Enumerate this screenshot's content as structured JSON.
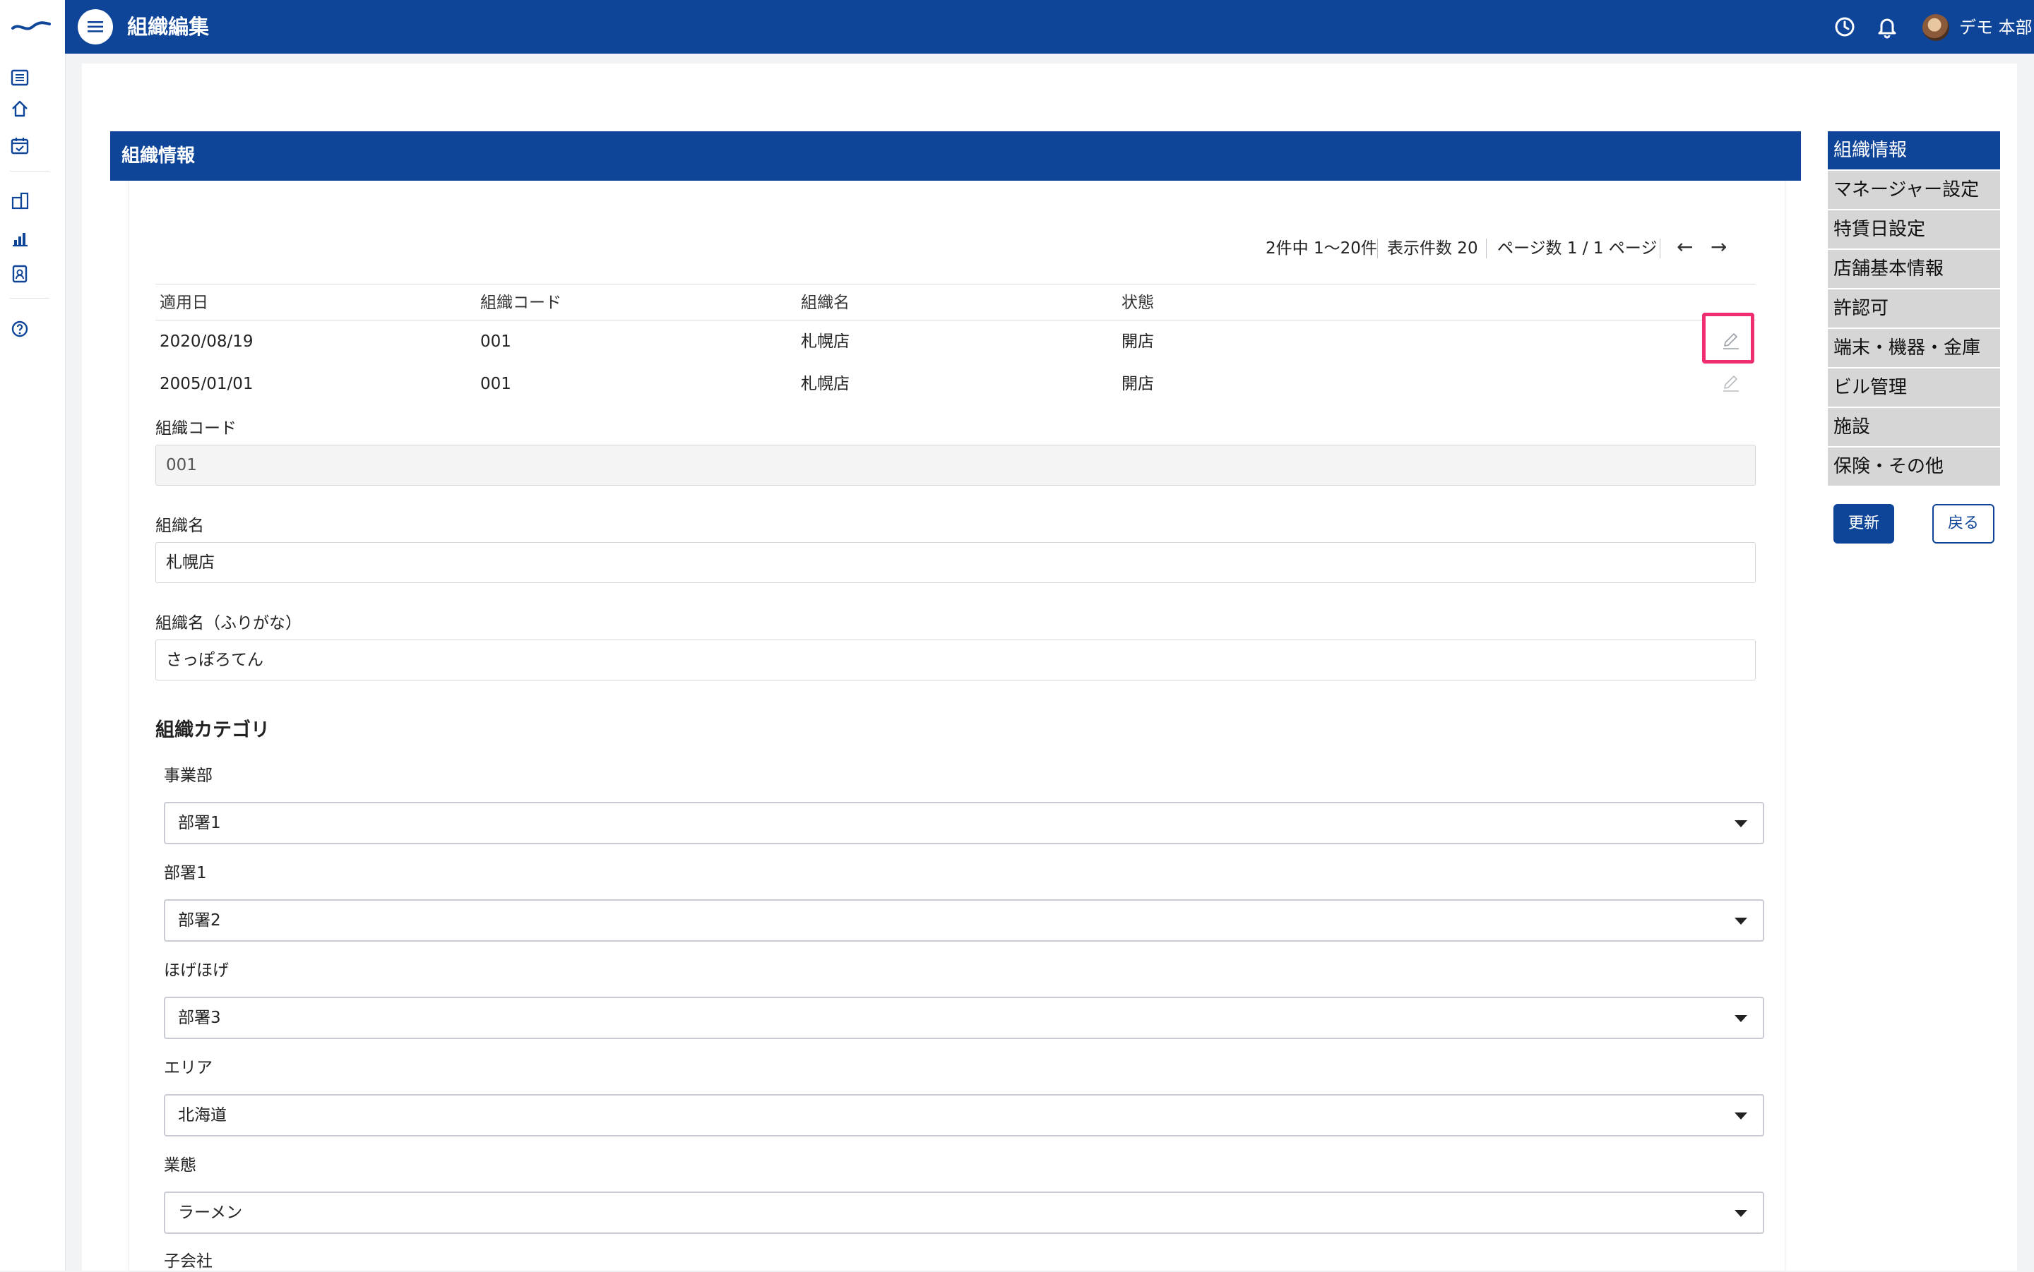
{
  "header": {
    "title": "組織編集",
    "user_name": "デモ 本部",
    "icons": [
      "hamburger-icon",
      "history-clock-icon",
      "bell-icon",
      "avatar"
    ]
  },
  "sidebar": {
    "icons": [
      "list-icon",
      "home-icon",
      "calendar-check-icon",
      "building-icon",
      "bar-chart-icon",
      "id-badge-icon",
      "help-icon"
    ]
  },
  "section": {
    "title": "組織情報"
  },
  "pagination": {
    "summary": "2件中 1〜20件",
    "per_page": "表示件数 20",
    "pages": "ページ数 1 / 1 ページ",
    "prev": "←",
    "next": "→"
  },
  "history_table": {
    "headers": [
      "適用日",
      "組織コード",
      "組織名",
      "状態"
    ],
    "rows": [
      {
        "date": "2020/08/19",
        "code": "001",
        "name": "札幌店",
        "status": "開店"
      },
      {
        "date": "2005/01/01",
        "code": "001",
        "name": "札幌店",
        "status": "開店"
      }
    ]
  },
  "form": {
    "code_label": "組織コード",
    "code_value": "001",
    "name_label": "組織名",
    "name_value": "札幌店",
    "kana_label": "組織名（ふりがな）",
    "kana_value": "さっぽろてん"
  },
  "category": {
    "title": "組織カテゴリ",
    "fields": [
      {
        "label": "事業部",
        "value": "部署1"
      },
      {
        "label": "部署1",
        "value": "部署2"
      },
      {
        "label": "ほげほげ",
        "value": "部署3"
      },
      {
        "label": "エリア",
        "value": "北海道"
      },
      {
        "label": "業態",
        "value": "ラーメン"
      },
      {
        "label": "子会社",
        "value": ""
      }
    ]
  },
  "right_nav": {
    "items": [
      "組織情報",
      "マネージャー設定",
      "特賃日設定",
      "店舗基本情報",
      "許認可",
      "端末・機器・金庫",
      "ビル管理",
      "施設",
      "保険・その他"
    ],
    "active": "組織情報",
    "update_label": "更新",
    "back_label": "戻る"
  },
  "colors": {
    "brand": "#0f4598",
    "highlight": "#ee2e71",
    "nav_bg": "#d6d6d6"
  }
}
